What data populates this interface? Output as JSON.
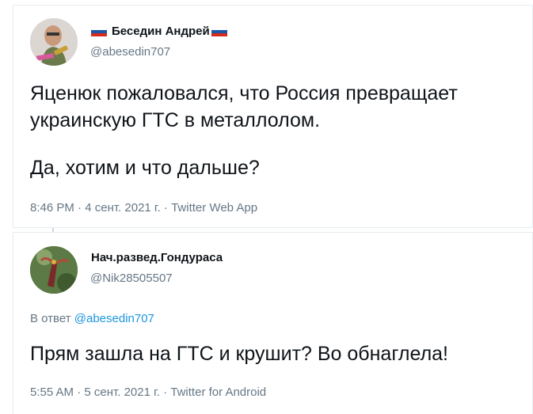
{
  "tweet1": {
    "display_name": "Беседин Андрей",
    "handle": "@abesedin707",
    "text_line1": "Яценюк пожаловался, что Россия превращает",
    "text_line2": "украинскую ГТС в металлолом.",
    "text_line3": "Да, хотим и что дальше?",
    "time": "8:46 PM",
    "date": "4 сент. 2021 г.",
    "source": "Twitter Web App",
    "separator": "·",
    "flag_icon": "russia-flag-icon"
  },
  "tweet2": {
    "display_name": "Нач.развед.Гондураса",
    "handle": "@Nik28505507",
    "reply_prefix": "В ответ",
    "reply_handle": "@abesedin707",
    "text": "Прям зашла на ГТС и крушит? Во обнаглела!",
    "time": "5:55 AM",
    "date": "5 сент. 2021 г.",
    "source": "Twitter for Android",
    "separator": "·"
  },
  "colors": {
    "secondary_text": "#657786",
    "link": "#1b95e0",
    "border": "#e6ecf0"
  }
}
